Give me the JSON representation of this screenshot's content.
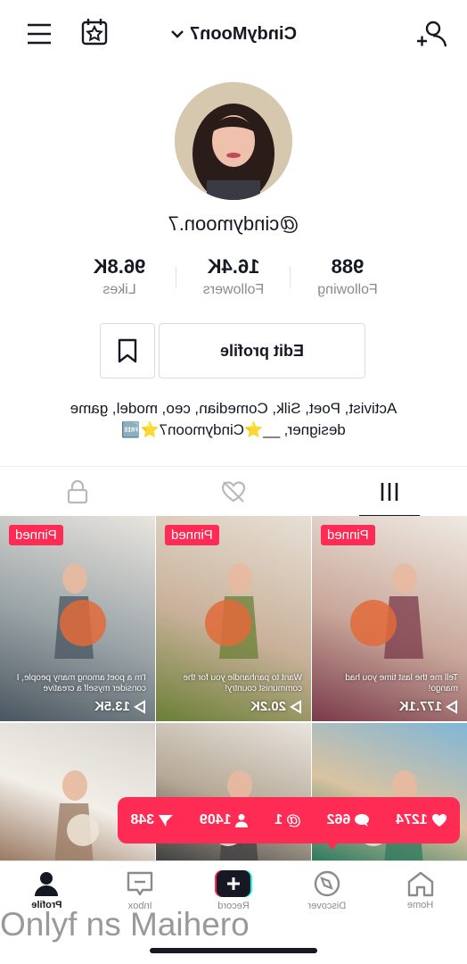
{
  "header": {
    "username_title": "CindyMoon7"
  },
  "profile": {
    "handle": "@cindymoon.7",
    "stats": [
      {
        "value": "988",
        "label": "Following"
      },
      {
        "value": "16.4K",
        "label": "Followers"
      },
      {
        "value": "96.8K",
        "label": "Likes"
      }
    ],
    "edit_label": "Edit profile",
    "bio_line1": "Activist, Poet, Silk, Comedian, ceo, model, game",
    "bio_line2": "designer, __⭐Cindymoon7⭐🆓"
  },
  "tabs": [
    {
      "name": "videos",
      "icon": "grid-icon",
      "active": true
    },
    {
      "name": "liked",
      "icon": "hidden-heart-icon",
      "active": false
    },
    {
      "name": "private",
      "icon": "lock-icon",
      "active": false
    }
  ],
  "videos": [
    {
      "pinned": "Pinned",
      "views": "177.1K",
      "caption": "Tell me the last time you had mango!",
      "colors": [
        "#efeae3",
        "#c9a89a",
        "#7a3a4a"
      ]
    },
    {
      "pinned": "Pinned",
      "views": "20.2K",
      "caption": "Want to panhandle you for the communist country!",
      "colors": [
        "#e7e0d5",
        "#c9b19a",
        "#6a7f35"
      ]
    },
    {
      "pinned": "Pinned",
      "views": "13.5K",
      "caption": "I'm a poet among many people, I consider myself a creative",
      "colors": [
        "#e9e5df",
        "#9aa3a6",
        "#4a5660"
      ]
    },
    {
      "pinned": "",
      "views": "",
      "caption": "",
      "colors": [
        "#7fb6d8",
        "#d9c3a2",
        "#2e7a5e"
      ]
    },
    {
      "pinned": "",
      "views": "",
      "caption": "",
      "colors": [
        "#e8e4de",
        "#b6a996",
        "#404040"
      ]
    },
    {
      "pinned": "",
      "views": "",
      "caption": "",
      "colors": [
        "#d7d2cc",
        "#f2efe9",
        "#9a7a62"
      ]
    }
  ],
  "pill": {
    "likes": "1274",
    "comments": "662",
    "mentions": "1",
    "followers": "1409",
    "shares": "348"
  },
  "nav": [
    {
      "label": "Home",
      "icon": "home-icon"
    },
    {
      "label": "Discover",
      "icon": "compass-icon"
    },
    {
      "label": "Record",
      "icon": "record-plus-icon"
    },
    {
      "label": "Inbox",
      "icon": "inbox-icon"
    },
    {
      "label": "Profile",
      "icon": "profile-icon"
    }
  ],
  "watermark": "Onlyf ns Maihero",
  "colors": {
    "accent": "#fe2c55",
    "text": "#161823",
    "muted": "#8a8b91"
  }
}
